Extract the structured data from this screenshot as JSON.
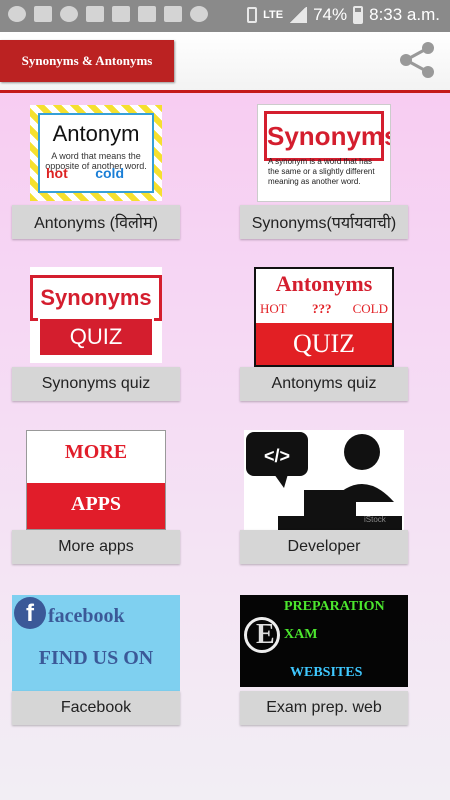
{
  "status_bar": {
    "network": "LTE",
    "battery": "74%",
    "time": "8:33 a.m.",
    "icons": [
      "chat-icon",
      "image-icon",
      "map-icon",
      "gmail-icon",
      "gmail-icon",
      "ltx-icon",
      "youtube-icon",
      "wifi-icon",
      "volte-icon",
      "sim-icon",
      "lte-icon",
      "signal-icon",
      "battery-icon"
    ]
  },
  "app_bar": {
    "title": "Synonyms & Antonyms",
    "share_icon": "share-icon",
    "accent": "#bb2222"
  },
  "tiles": [
    {
      "label": "Antonyms (विलोम)",
      "thumb": {
        "title": "Antonym",
        "text": "A word that means the opposite of another word.",
        "hot": "hot",
        "cold": "cold"
      }
    },
    {
      "label": "Synonyms(पर्यायवाची)",
      "thumb": {
        "title": "Synonyms",
        "text": "A synonym is a word that has the same or a slightly different meaning as another word."
      }
    },
    {
      "label": "Synonyms quiz",
      "thumb": {
        "title": "Synonyms",
        "quiz": "QUIZ"
      }
    },
    {
      "label": "Antonyms quiz",
      "thumb": {
        "title": "Antonyms",
        "hot": "HOT",
        "marks": "???",
        "cold": "COLD",
        "quiz": "QUIZ"
      }
    },
    {
      "label": "More apps",
      "thumb": {
        "top": "MORE",
        "bottom": "APPS"
      }
    },
    {
      "label": "Developer",
      "thumb": {
        "code": "</>",
        "watermark": "iStock"
      }
    },
    {
      "label": "Facebook",
      "thumb": {
        "top": "facebook",
        "bottom": "FIND US ON"
      }
    },
    {
      "label": "Exam prep. web",
      "thumb": {
        "line1": "PREPARATION",
        "letter": "E",
        "line2": "XAM",
        "line3": "WEBSITES"
      }
    }
  ]
}
